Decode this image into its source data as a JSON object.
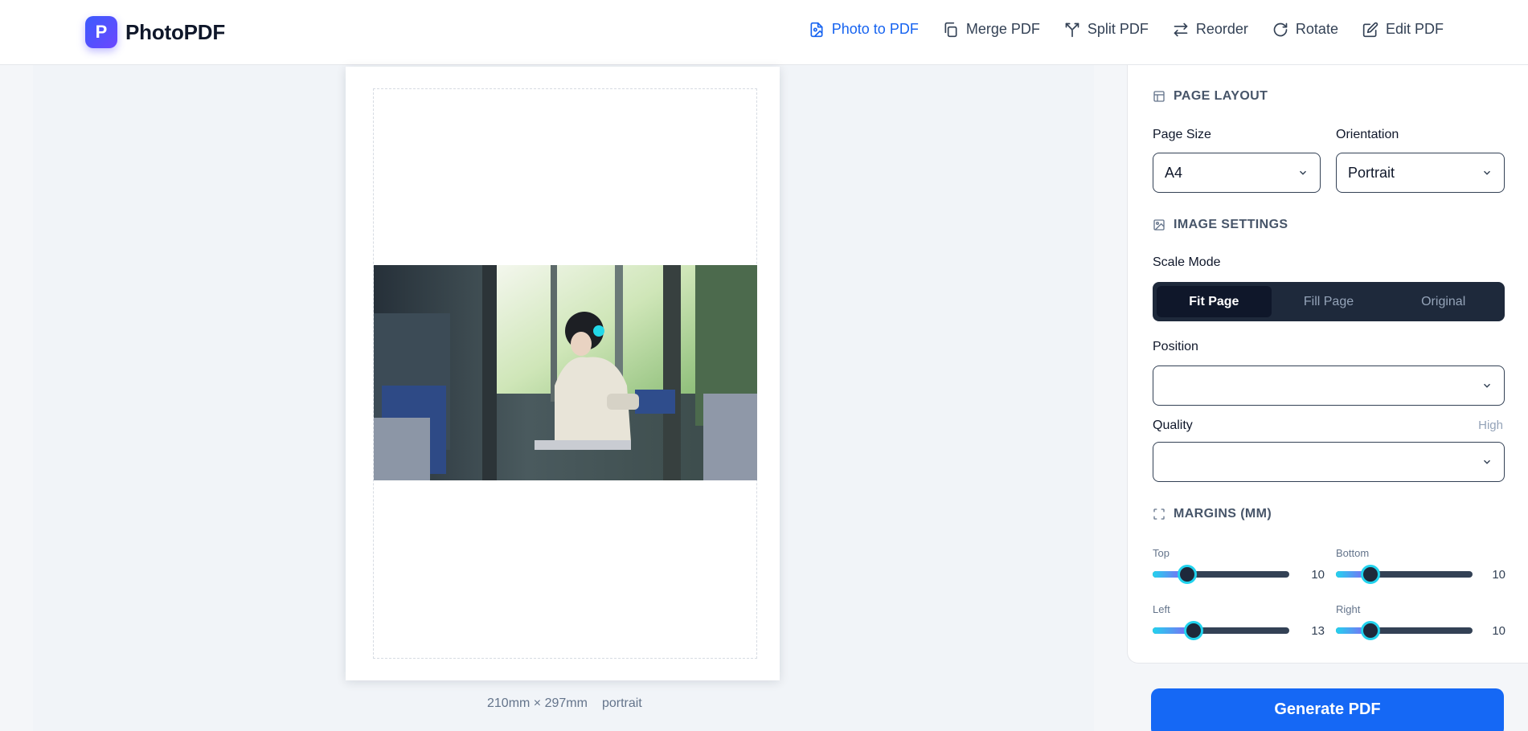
{
  "brand": {
    "badge": "P",
    "name": "PhotoPDF",
    "accent": "#1663f0"
  },
  "nav": [
    {
      "label": "Photo to PDF",
      "icon": "file-image-icon",
      "active": true
    },
    {
      "label": "Merge PDF",
      "icon": "copy-icon",
      "active": false
    },
    {
      "label": "Split PDF",
      "icon": "split-icon",
      "active": false
    },
    {
      "label": "Reorder",
      "icon": "arrows-icon",
      "active": false
    },
    {
      "label": "Rotate",
      "icon": "rotate-icon",
      "active": false
    },
    {
      "label": "Edit PDF",
      "icon": "edit-icon",
      "active": false
    }
  ],
  "preview": {
    "dimensions": "210mm × 297mm",
    "orientation": "portrait"
  },
  "panel": {
    "page_layout_title": "PAGE LAYOUT",
    "page_size_label": "Page Size",
    "page_size_value": "A4",
    "orientation_label": "Orientation",
    "orientation_value": "Portrait",
    "image_settings_title": "IMAGE SETTINGS",
    "scale_mode_label": "Scale Mode",
    "scale_modes": [
      "Fit Page",
      "Fill Page",
      "Original"
    ],
    "scale_mode_selected": "Fit Page",
    "position_label": "Position",
    "position_value": "",
    "quality_label": "Quality",
    "quality_value": "High",
    "quality_select_value": "",
    "margins_title": "MARGINS (MM)",
    "margins": {
      "top": {
        "label": "Top",
        "value": "10",
        "fraction": 0.25
      },
      "bottom": {
        "label": "Bottom",
        "value": "10",
        "fraction": 0.25
      },
      "left": {
        "label": "Left",
        "value": "13",
        "fraction": 0.3
      },
      "right": {
        "label": "Right",
        "value": "10",
        "fraction": 0.25
      }
    }
  },
  "generate_button": "Generate PDF"
}
